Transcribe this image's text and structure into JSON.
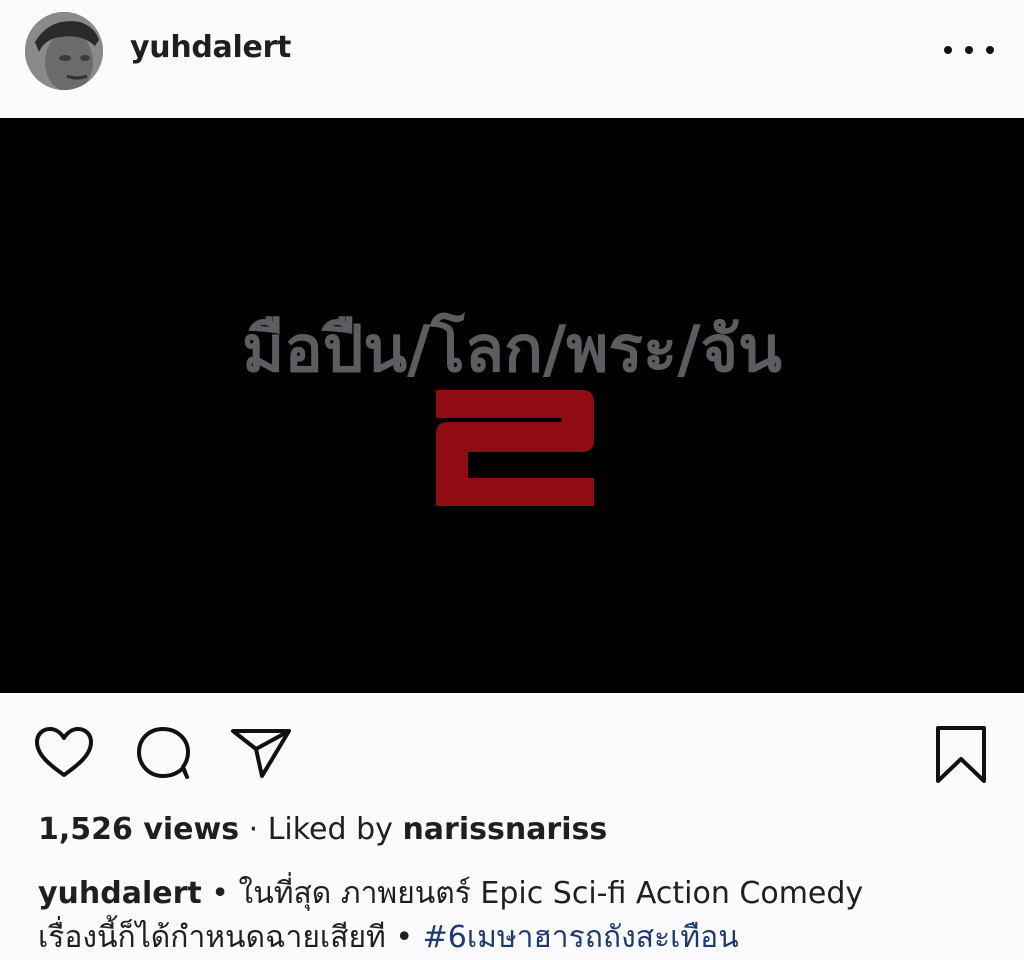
{
  "post": {
    "username": "yuhdalert",
    "more_options": "•••"
  },
  "media": {
    "title_text": "มือปืน/โลก/พระ/จัน",
    "number_text": "2",
    "title_color": "#5d5c61",
    "number_color": "#8f0d12"
  },
  "actions": {
    "like_icon": "heart-icon",
    "comment_icon": "comment-icon",
    "share_icon": "paper-plane-icon",
    "save_icon": "bookmark-icon"
  },
  "stats": {
    "views": "1,526 views",
    "separator": " · ",
    "liked_by_prefix": "Liked by ",
    "liked_by_user": "narissnariss"
  },
  "caption": {
    "username": "yuhdalert",
    "bullet": " • ",
    "line1_text": "ในที่สุด ภาพยนตร์ Epic Sci-fi Action Comedy",
    "line2_text": "เรื่องนี้ก็ได้กำหนดฉายเสียที",
    "bullet2": " • ",
    "hashtag": "#6เมษาฮารถถังสะเทือน"
  }
}
